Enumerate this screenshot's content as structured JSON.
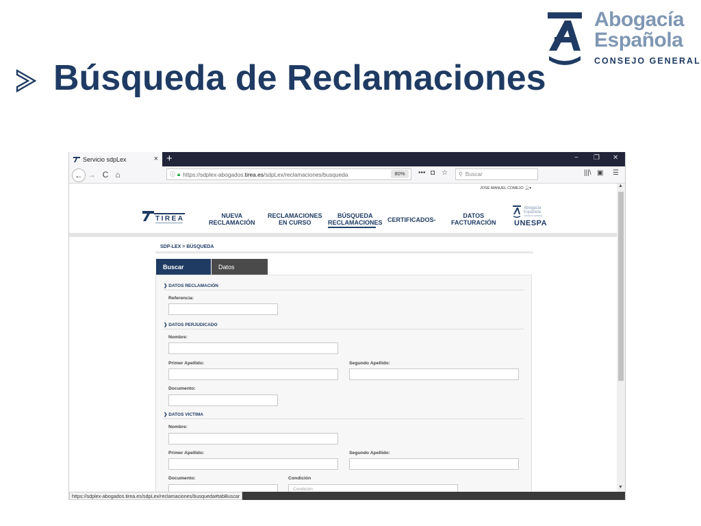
{
  "slide": {
    "title": "Búsqueda de Reclamaciones",
    "logo": {
      "line1": "Abogacía",
      "line2": "Española",
      "line3": "CONSEJO GENERAL"
    },
    "colors": {
      "brand_navy": "#1f3b63",
      "logo_grey_blue": "#7f97b3"
    }
  },
  "browser": {
    "tab_title": "Servicio sdpLex",
    "tab_close": "×",
    "new_tab": "+",
    "window_controls": {
      "minimize": "−",
      "restore": "❐",
      "close": "✕"
    },
    "nav": {
      "back": "←",
      "forward": "→",
      "reload": "C",
      "home": "⌂"
    },
    "url": {
      "prefix": "https://sdplex-abogados.",
      "domain": "tirea.es",
      "path": "/sdpLex/reclamaciones/busqueda"
    },
    "zoom": "80%",
    "search_placeholder": "Buscar",
    "status_url": "https://sdplex-abogados.tirea.es/sdpLex/reclamaciones/busqueda#tabBuscar"
  },
  "page": {
    "user_name": "JOSÉ MANUEL COMEJO",
    "tirea_label": "TIREA",
    "menu": [
      {
        "line1": "NUEVA",
        "line2": "RECLAMACIÓN"
      },
      {
        "line1": "RECLAMACIONES",
        "line2": "EN CURSO"
      },
      {
        "line1": "BÚSQUEDA",
        "line2": "RECLAMACIONES",
        "active": true
      },
      {
        "line1": "CERTIFICADOS-",
        "line2": ""
      },
      {
        "line1": "DATOS",
        "line2": "FACTURACIÓN"
      }
    ],
    "partner_logo": {
      "small1": "Abogacía",
      "small2": "Española",
      "small3": "CONSEJO GENERAL",
      "text": "UNESPA"
    },
    "breadcrumb": "SDP-LEX > BÚSQUEDA",
    "tabs": {
      "buscar": "Buscar",
      "datos": "Datos"
    },
    "sections": {
      "reclamacion": "DATOS RECLAMACIÓN",
      "perjudicado": "DATOS PERJUDICADO",
      "victima": "DATOS VICTIMA"
    },
    "labels": {
      "referencia": "Referencia:",
      "nombre": "Nombre:",
      "primer_apellido": "Primer Apellido:",
      "segundo_apellido": "Segundo Apellido:",
      "documento": "Documento:",
      "condicion": "Condición"
    },
    "condicion_placeholder": "Condición"
  }
}
